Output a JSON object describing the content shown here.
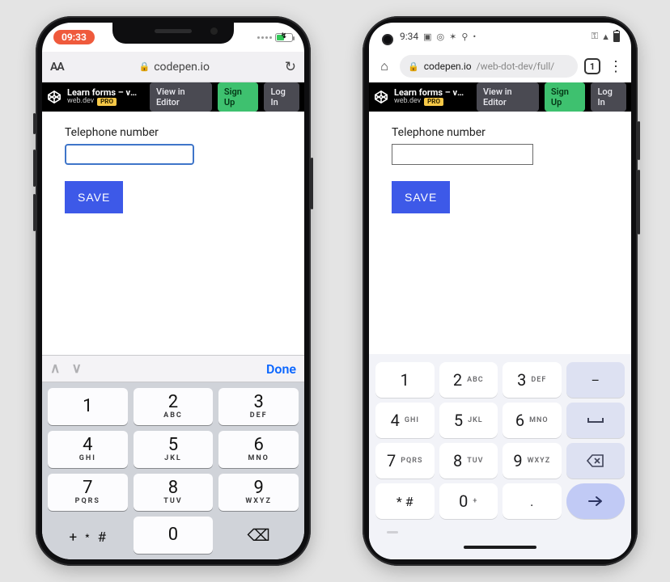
{
  "ios": {
    "status": {
      "time": "09:33"
    },
    "safari": {
      "domain": "codepen.io",
      "aA": "AA"
    },
    "codepen": {
      "title": "Learn forms – virt…",
      "author": "web.dev",
      "pro": "PRO",
      "view": "View in Editor",
      "signup": "Sign Up",
      "login": "Log In"
    },
    "form": {
      "label": "Telephone number",
      "save": "SAVE"
    },
    "keyboard": {
      "done": "Done",
      "keys": [
        {
          "d": "1",
          "l": ""
        },
        {
          "d": "2",
          "l": "ABC"
        },
        {
          "d": "3",
          "l": "DEF"
        },
        {
          "d": "4",
          "l": "GHI"
        },
        {
          "d": "5",
          "l": "JKL"
        },
        {
          "d": "6",
          "l": "MNO"
        },
        {
          "d": "7",
          "l": "PQRS"
        },
        {
          "d": "8",
          "l": "TUV"
        },
        {
          "d": "9",
          "l": "WXYZ"
        }
      ],
      "sym": "+ ﹡ #",
      "zero": "0",
      "del": "⌫"
    }
  },
  "android": {
    "status": {
      "time": "9:34"
    },
    "chrome": {
      "url_host": "codepen.io",
      "url_path": "/web-dot-dev/full/",
      "tabs": "1"
    },
    "codepen": {
      "title": "Learn forms – virt…",
      "author": "web.dev",
      "pro": "PRO",
      "view": "View in Editor",
      "signup": "Sign Up",
      "login": "Log In"
    },
    "form": {
      "label": "Telephone number",
      "save": "SAVE"
    },
    "keyboard": {
      "keys": [
        {
          "d": "1",
          "l": ""
        },
        {
          "d": "2",
          "l": "ABC"
        },
        {
          "d": "3",
          "l": "DEF"
        },
        {
          "d": "–",
          "alt": true,
          "sym": true
        },
        {
          "d": "4",
          "l": "GHI"
        },
        {
          "d": "5",
          "l": "JKL"
        },
        {
          "d": "6",
          "l": "MNO"
        },
        {
          "d": "␣",
          "alt": true,
          "svg": "space"
        },
        {
          "d": "7",
          "l": "PQRS"
        },
        {
          "d": "8",
          "l": "TUV"
        },
        {
          "d": "9",
          "l": "WXYZ"
        },
        {
          "d": "⌫",
          "alt": true,
          "svg": "del"
        },
        {
          "d": "* #",
          "sym": true
        },
        {
          "d": "0",
          "l": "+"
        },
        {
          "d": ".",
          "sym": true
        },
        {
          "d": "→",
          "go": true,
          "svg": "go"
        }
      ]
    }
  }
}
